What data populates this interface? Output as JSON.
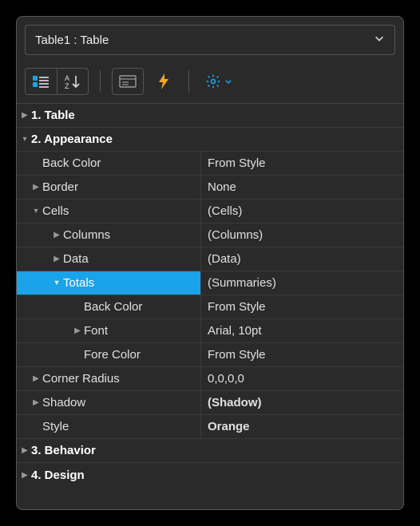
{
  "combo": {
    "text": "Table1 : Table"
  },
  "categories": {
    "table": "1. Table",
    "appearance": "2. Appearance",
    "behavior": "3. Behavior",
    "design": "4. Design"
  },
  "properties": {
    "backColor": {
      "name": "Back Color",
      "value": "From Style"
    },
    "border": {
      "name": "Border",
      "value": "None"
    },
    "cells": {
      "name": "Cells",
      "value": "(Cells)"
    },
    "columns": {
      "name": "Columns",
      "value": "(Columns)"
    },
    "data": {
      "name": "Data",
      "value": "(Data)"
    },
    "totals": {
      "name": "Totals",
      "value": "(Summaries)"
    },
    "totalsBackColor": {
      "name": "Back Color",
      "value": "From Style"
    },
    "totalsFont": {
      "name": "Font",
      "value": "Arial, 10pt"
    },
    "totalsForeColor": {
      "name": "Fore Color",
      "value": "From Style"
    },
    "cornerRadius": {
      "name": "Corner Radius",
      "value": "0,0,0,0"
    },
    "shadow": {
      "name": "Shadow",
      "value": "(Shadow)"
    },
    "style": {
      "name": "Style",
      "value": "Orange"
    }
  }
}
